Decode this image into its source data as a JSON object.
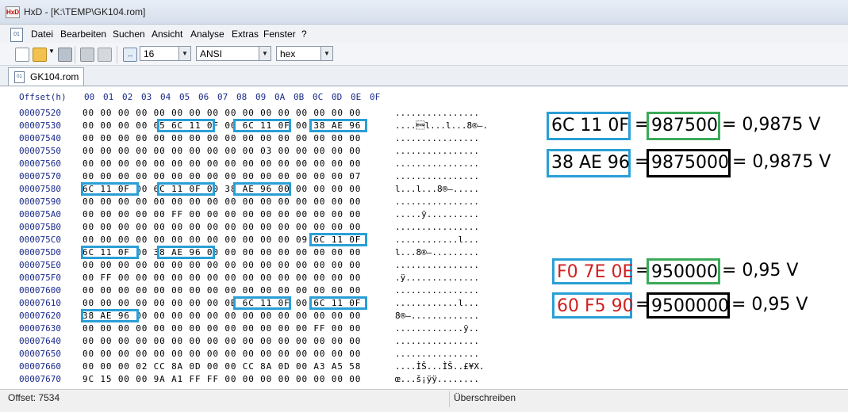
{
  "window": {
    "title": "HxD - [K:\\TEMP\\GK104.rom]",
    "icon": "hxd-app-icon"
  },
  "menu": [
    "Datei",
    "Bearbeiten",
    "Suchen",
    "Ansicht",
    "Analyse",
    "Extras",
    "Fenster",
    "?"
  ],
  "toolbar": {
    "bytes_per_row": "16",
    "charset": "ANSI",
    "offset_base": "hex",
    "icons": [
      "new-file-icon",
      "open-file-icon",
      "save-icon",
      "edit-ram-icon",
      "open-disk-icon",
      "bytes-per-row-icon"
    ]
  },
  "tab": {
    "label": "GK104.rom"
  },
  "hex": {
    "offset_header": "Offset(h)",
    "columns": [
      "00",
      "01",
      "02",
      "03",
      "04",
      "05",
      "06",
      "07",
      "08",
      "09",
      "0A",
      "0B",
      "0C",
      "0D",
      "0E",
      "0F"
    ],
    "rows": [
      {
        "addr": "00007520",
        "bytes": "00 00 00 00 00 00 00 00 00 00 00 00 00 00 00 00",
        "ascii": "................"
      },
      {
        "addr": "00007530",
        "bytes": "00 00 00 00 05 6C 11 0F 00 6C 11 0F 00 38 AE 96",
        "ascii": "....\u0005l...l...8®–."
      },
      {
        "addr": "00007540",
        "bytes": "00 00 00 00 00 00 00 00 00 00 00 00 00 00 00 00",
        "ascii": "................"
      },
      {
        "addr": "00007550",
        "bytes": "00 00 00 00 00 00 00 00 00 00 03 00 00 00 00 00",
        "ascii": "................"
      },
      {
        "addr": "00007560",
        "bytes": "00 00 00 00 00 00 00 00 00 00 00 00 00 00 00 00",
        "ascii": "................"
      },
      {
        "addr": "00007570",
        "bytes": "00 00 00 00 00 00 00 00 00 00 00 00 00 00 00 07",
        "ascii": "................"
      },
      {
        "addr": "00007580",
        "bytes": "6C 11 0F 00 6C 11 0F 00 38 AE 96 00 00 00 00 00",
        "ascii": "l...l...8®–....."
      },
      {
        "addr": "00007590",
        "bytes": "00 00 00 00 00 00 00 00 00 00 00 00 00 00 00 00",
        "ascii": "................"
      },
      {
        "addr": "000075A0",
        "bytes": "00 00 00 00 00 FF 00 00 00 00 00 00 00 00 00 00",
        "ascii": ".....ÿ.........."
      },
      {
        "addr": "000075B0",
        "bytes": "00 00 00 00 00 00 00 00 00 00 00 00 00 00 00 00",
        "ascii": "................"
      },
      {
        "addr": "000075C0",
        "bytes": "00 00 00 00 00 00 00 00 00 00 00 00 09 6C 11 0F",
        "ascii": "............l..."
      },
      {
        "addr": "000075D0",
        "bytes": "6C 11 0F 00 38 AE 96 00 00 00 00 00 00 00 00 00",
        "ascii": "l...8®–........."
      },
      {
        "addr": "000075E0",
        "bytes": "00 00 00 00 00 00 00 00 00 00 00 00 00 00 00 00",
        "ascii": "................"
      },
      {
        "addr": "000075F0",
        "bytes": "00 FF 00 00 00 00 00 00 00 00 00 00 00 00 00 00",
        "ascii": ".ÿ.............."
      },
      {
        "addr": "00007600",
        "bytes": "00 00 00 00 00 00 00 00 00 00 00 00 00 00 00 00",
        "ascii": "................"
      },
      {
        "addr": "00007610",
        "bytes": "00 00 00 00 00 00 00 00 0B 6C 11 0F 00 6C 11 0F",
        "ascii": "............l..."
      },
      {
        "addr": "00007620",
        "bytes": "38 AE 96 00 00 00 00 00 00 00 00 00 00 00 00 00",
        "ascii": "8®–............."
      },
      {
        "addr": "00007630",
        "bytes": "00 00 00 00 00 00 00 00 00 00 00 00 00 FF 00 00",
        "ascii": ".............ÿ.."
      },
      {
        "addr": "00007640",
        "bytes": "00 00 00 00 00 00 00 00 00 00 00 00 00 00 00 00",
        "ascii": "................"
      },
      {
        "addr": "00007650",
        "bytes": "00 00 00 00 00 00 00 00 00 00 00 00 00 00 00 00",
        "ascii": "................"
      },
      {
        "addr": "00007660",
        "bytes": "00 00 00 02 CC 8A 0D 00 00 CC 8A 0D 00 A3 A5 58",
        "ascii": "....ÌŠ...ÌŠ..£¥X."
      },
      {
        "addr": "00007670",
        "bytes": "9C 15 00 00 9A A1 FF FF 00 00 00 00 00 00 00 00",
        "ascii": "œ...š¡ÿÿ........"
      }
    ]
  },
  "annotations": {
    "a1": {
      "hex": "6C 11 0F",
      "eq": "=",
      "dec": "987500",
      "result": "= 0,9875 V"
    },
    "a2": {
      "hex": "38 AE 96",
      "eq": "=",
      "dec": "9875000",
      "result": "= 0,9875 V"
    },
    "a3": {
      "hex": "F0 7E 0E",
      "eq": "=",
      "dec": "950000",
      "result": "= 0,95 V"
    },
    "a4": {
      "hex": "60 F5 90",
      "eq": "=",
      "dec": "9500000",
      "result": "= 0,95 V"
    }
  },
  "status": {
    "offset": "Offset: 7534",
    "mode": "Überschreiben"
  },
  "colors": {
    "highlight_blue": "#2a9fd6",
    "green": "#3caa58",
    "red": "#d02020",
    "offset_text": "#1a2a8a"
  }
}
